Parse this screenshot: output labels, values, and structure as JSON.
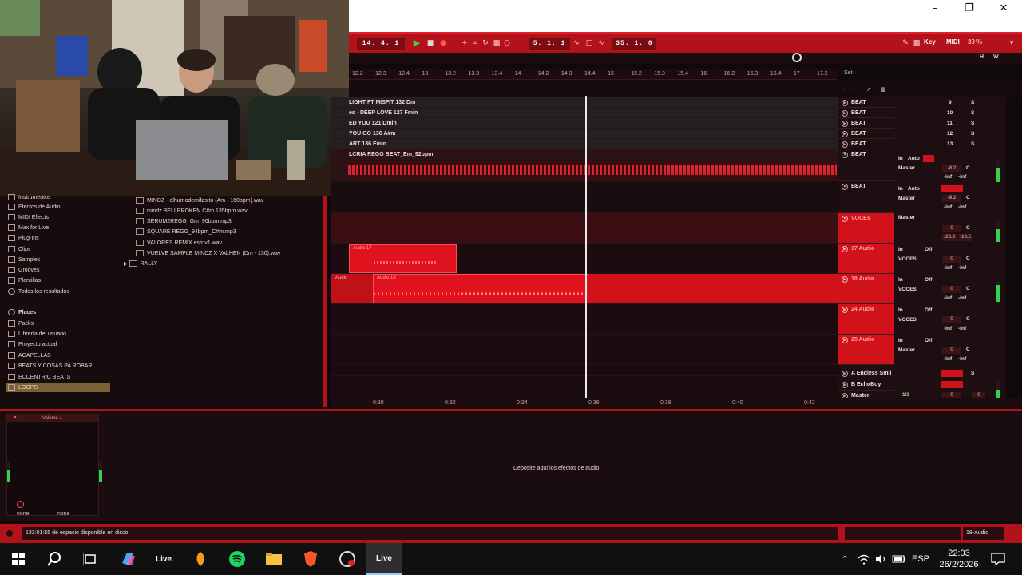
{
  "transport": {
    "position": "14.  4.  1",
    "loop_start": "5.  1.  1",
    "loop_length": "35.  1.  0",
    "key_label": "Key",
    "midi_label": "MIDI",
    "cpu": "39 %",
    "w_label": "W",
    "h_label": "H"
  },
  "ruler": {
    "ticks": [
      "12.2",
      "12.3",
      "12.4",
      "13",
      "13.2",
      "13.3",
      "13.4",
      "14",
      "14.2",
      "14.3",
      "14.4",
      "15",
      "15.2",
      "15.3",
      "15.4",
      "16",
      "16.2",
      "16.3",
      "16.4",
      "17",
      "17.2"
    ],
    "set_label": "Set"
  },
  "clips": {
    "rows": [
      "LIGHT FT MISFIT 132 Dm",
      "es - DEEP LOVE 127 Fmin",
      "ED YOU 121 Dmin",
      "YOU GO 136 A#m",
      "ART 136 Emin",
      "LCRIA REGG BEAT_Em_92bpm"
    ],
    "audio_clip_1": "Audio 17",
    "audio_clip_2a": "Audio",
    "audio_clip_2b": "Audio 18"
  },
  "tracks": {
    "beat_small": [
      {
        "name": "BEAT",
        "num": "9"
      },
      {
        "name": "BEAT",
        "num": "10"
      },
      {
        "name": "BEAT",
        "num": "11"
      },
      {
        "name": "BEAT",
        "num": "12"
      },
      {
        "name": "BEAT",
        "num": "13"
      }
    ],
    "beat_big_1": {
      "name": "BEAT",
      "in": "In",
      "auto": "Auto",
      "off": "Off",
      "master": "Master",
      "vol": "-8.2",
      "pan": "C",
      "inf1": "-inf",
      "inf2": "-inf"
    },
    "beat_big_2": {
      "name": "BEAT",
      "in": "In",
      "auto": "Auto",
      "master": "Master",
      "vol": "-8.2",
      "pan": "C",
      "inf1": "-inf",
      "inf2": "-inf"
    },
    "voces": {
      "name": "VOCES",
      "master": "Master",
      "vol": "0",
      "pan": "C",
      "peak1": "-23.3",
      "peak2": "-18.5"
    },
    "audio17": {
      "name": "17 Audio",
      "in": "In",
      "off": "Off",
      "route": "VOCES",
      "vol": "0",
      "pan": "C",
      "inf1": "-inf",
      "inf2": "-inf"
    },
    "audio18": {
      "name": "18 Audio",
      "in": "In",
      "off": "Off",
      "route": "VOCES",
      "vol": "0",
      "pan": "C",
      "inf1": "-inf",
      "inf2": "-inf"
    },
    "audio24": {
      "name": "24 Audio",
      "in": "In",
      "off": "Off",
      "route": "VOCES",
      "vol": "0",
      "pan": "C",
      "inf1": "-inf",
      "inf2": "-inf"
    },
    "audio25": {
      "name": "25 Audio",
      "in": "In",
      "off": "Off",
      "route": "Master",
      "vol": "0",
      "pan": "C",
      "inf1": "-inf",
      "inf2": "-inf"
    },
    "return_a": {
      "name": "A Endless Smil",
      "s": "S"
    },
    "return_b": {
      "name": "B EchoBoy"
    },
    "master": {
      "name": "Master",
      "route": "1/2",
      "vol": "0",
      "pan": "0"
    },
    "solo": "S",
    "pan_c": "C"
  },
  "timebar": {
    "ticks": [
      "0:30",
      "0:32",
      "0:34",
      "0:36",
      "0:38",
      "0:40",
      "0:42"
    ]
  },
  "browser": {
    "categories": [
      "Instrumentos",
      "Efectos de Audio",
      "MIDI Effects",
      "Max for Live",
      "Plug-Ins",
      "Clips",
      "Samples",
      "Grooves",
      "Plantillas",
      "Todos los resultados"
    ],
    "places_header": "Places",
    "places": [
      "Packs",
      "Librería del usuario",
      "Proyecto actual",
      "ACAPELLAS",
      "BEATS Y COSAS PA ROBAR",
      "ECCENTRIC BEATS",
      "LOOPS"
    ],
    "files": [
      "MINDZ - elhumodemifasito (Am - 160bpm).wav",
      "mindz  BELLBROKEN  C#m  135bpm.wav",
      "SERUM2REGG_Gm_90bpm.mp3",
      "SQUARE REGG_94bpm_C#m.mp3",
      "VALORES REMIX  estr  v1.wav",
      "VUELVE SAMPLE  MINDZ X VALHEN (Dm - 130).wav"
    ],
    "folder": "RALLY"
  },
  "detail": {
    "device_name": "Valores 1",
    "drop_text": "Deposite aquí los efectos de audio",
    "none1": "none",
    "none2": "none"
  },
  "status": {
    "message": "133:01:55 de espacio disponible en disco.",
    "track": "18-Audio"
  },
  "taskbar": {
    "live1": "Live",
    "live2": "Live",
    "lang": "ESP",
    "time": "22:03",
    "date": "26/2/2026"
  },
  "colors": {
    "accent": "#d2121b",
    "bg": "#150b0d",
    "meter": "#35d14a"
  }
}
